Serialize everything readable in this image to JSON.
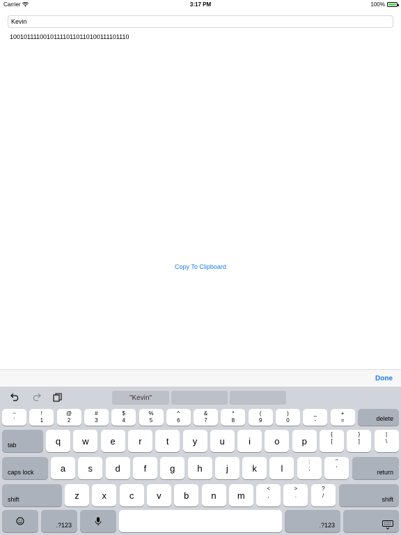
{
  "status_bar": {
    "carrier": "Carrier",
    "time": "3:17 PM",
    "battery_percent": "100%",
    "battery_level": 1.0
  },
  "name_input": {
    "value": "Kevin"
  },
  "binary_output": {
    "text": "100101111001011110110110100111101110"
  },
  "copy_button": {
    "label": "Copy To Clipboard"
  },
  "accessory_bar": {
    "done_label": "Done"
  },
  "keyboard": {
    "suggestions": [
      "\"Kevin\"",
      "",
      ""
    ],
    "row_numbers": [
      {
        "top": "~",
        "bottom": "`"
      },
      {
        "top": "!",
        "bottom": "1"
      },
      {
        "top": "@",
        "bottom": "2"
      },
      {
        "top": "#",
        "bottom": "3"
      },
      {
        "top": "$",
        "bottom": "4"
      },
      {
        "top": "%",
        "bottom": "5"
      },
      {
        "top": "^",
        "bottom": "6"
      },
      {
        "top": "&",
        "bottom": "7"
      },
      {
        "top": "*",
        "bottom": "8"
      },
      {
        "top": "(",
        "bottom": "9"
      },
      {
        "top": ")",
        "bottom": "0"
      },
      {
        "top": "_",
        "bottom": "-"
      },
      {
        "top": "+",
        "bottom": "="
      }
    ],
    "delete_label": "delete",
    "tab_label": "tab",
    "row_q": [
      "q",
      "w",
      "e",
      "r",
      "t",
      "y",
      "u",
      "i",
      "o",
      "p"
    ],
    "row_q_symbols": [
      {
        "top": "{",
        "bottom": "["
      },
      {
        "top": "}",
        "bottom": "]"
      },
      {
        "top": "|",
        "bottom": "\\"
      }
    ],
    "caps_label": "caps lock",
    "row_a": [
      "a",
      "s",
      "d",
      "f",
      "g",
      "h",
      "j",
      "k",
      "l"
    ],
    "row_a_symbols": [
      {
        "top": ":",
        "bottom": ";"
      },
      {
        "top": "\"",
        "bottom": "'"
      }
    ],
    "return_label": "return",
    "shift_label": "shift",
    "row_z": [
      "z",
      "x",
      "c",
      "v",
      "b",
      "n",
      "m"
    ],
    "row_z_symbols": [
      {
        "top": "<",
        "bottom": ","
      },
      {
        "top": ">",
        "bottom": "."
      },
      {
        "top": "?",
        "bottom": "/"
      }
    ],
    "numbers_label": ".?123",
    "icons": {
      "undo": "undo-icon",
      "redo": "redo-icon",
      "paste": "paste-icon",
      "emoji": "emoji-icon",
      "mic": "microphone-icon",
      "dismiss": "keyboard-dismiss-icon",
      "wifi": "wifi-icon"
    }
  }
}
